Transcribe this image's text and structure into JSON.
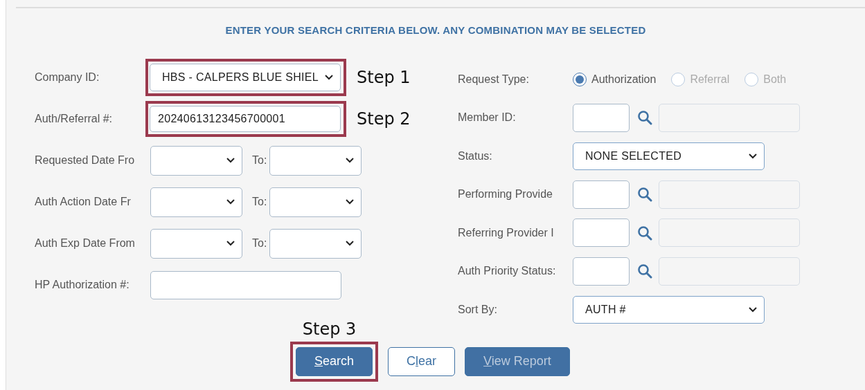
{
  "heading": "ENTER YOUR SEARCH CRITERIA BELOW. ANY COMBINATION MAY BE SELECTED",
  "left_fields": [
    {
      "kind": "select",
      "label": "Company ID:",
      "value": "HBS - CALPERS BLUE SHIEL",
      "highlighted": true,
      "step": "Step 1"
    },
    {
      "kind": "text",
      "label": "Auth/Referral #:",
      "value": "20240613123456700001",
      "highlighted": true,
      "step": "Step 2"
    },
    {
      "kind": "daterange",
      "label": "Requested Date Fro",
      "to_label": "To:",
      "highlighted": false
    },
    {
      "kind": "daterange",
      "label": "Auth Action Date Fr",
      "to_label": "To:",
      "highlighted": false
    },
    {
      "kind": "daterange",
      "label": "Auth Exp Date From",
      "to_label": "To:",
      "highlighted": false
    },
    {
      "kind": "text",
      "label": "HP Authorization #:",
      "highlighted": false
    }
  ],
  "right_fields": [
    {
      "kind": "radio",
      "label": "Request Type:",
      "options": [
        {
          "label": "Authorization",
          "selected": true,
          "disabled": false
        },
        {
          "label": "Referral",
          "selected": false,
          "disabled": true
        },
        {
          "label": "Both",
          "selected": false,
          "disabled": true
        }
      ]
    },
    {
      "kind": "lookup",
      "label": "Member ID:"
    },
    {
      "kind": "select",
      "label": "Status:",
      "value": "NONE SELECTED"
    },
    {
      "kind": "lookup",
      "label": "Performing Provide"
    },
    {
      "kind": "lookup",
      "label": "Referring Provider I"
    },
    {
      "kind": "lookup",
      "label": "Auth Priority Status:"
    },
    {
      "kind": "select",
      "label": "Sort By:",
      "value": "AUTH #"
    }
  ],
  "buttons_step": "Step 3",
  "buttons": [
    {
      "kind": "primary",
      "label_parts": [
        {
          "text": "S",
          "underlined": true
        },
        {
          "text": "earch",
          "underlined": false
        }
      ],
      "highlighted": true,
      "disabled": false
    },
    {
      "kind": "outline",
      "label_parts": [
        {
          "text": "C",
          "underlined": false
        },
        {
          "text": "l",
          "underlined": true
        },
        {
          "text": "ear",
          "underlined": false
        }
      ],
      "highlighted": false,
      "disabled": false
    },
    {
      "kind": "primary",
      "label_parts": [
        {
          "text": "V",
          "underlined": true
        },
        {
          "text": "iew Report",
          "underlined": false
        }
      ],
      "highlighted": false,
      "disabled": true
    }
  ]
}
